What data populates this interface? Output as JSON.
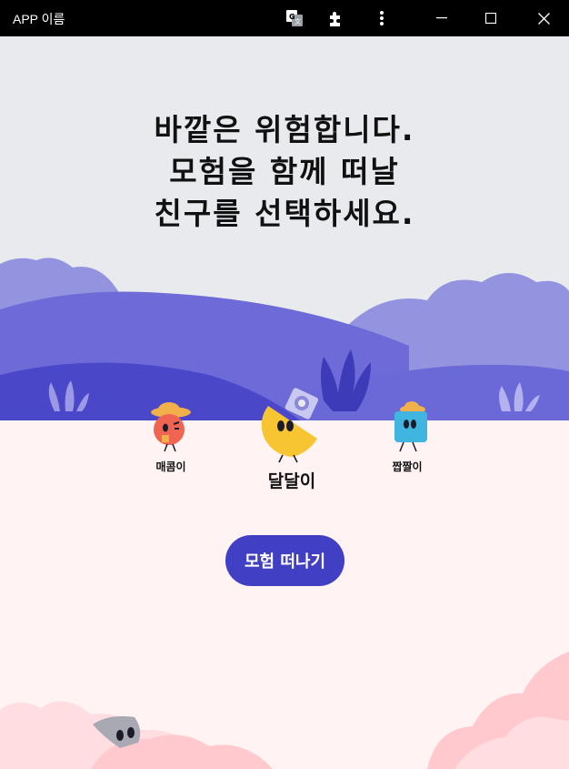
{
  "window": {
    "title": "APP 이름",
    "icons": [
      "translate-icon",
      "extension-icon",
      "more-vertical-icon",
      "minimize-icon",
      "maximize-icon",
      "close-icon"
    ]
  },
  "headline": {
    "line1": "바깥은 위험합니다.",
    "line2": "모험을 함께 떠날",
    "line3": "친구를 선택하세요."
  },
  "characters": [
    {
      "name": "매콤이",
      "selected": false
    },
    {
      "name": "달달이",
      "selected": true
    },
    {
      "name": "짭짤이",
      "selected": false
    }
  ],
  "start_button": {
    "label": "모험 떠나기"
  },
  "colors": {
    "titlebar": "#000000",
    "sky": "#e9eaee",
    "ground": "#fff3f4",
    "hill_light": "#9393e0",
    "hill_mid": "#6e6bd8",
    "hill_dark": "#4a47c9",
    "accent": "#4140c5",
    "cloud_pink": "#ffc9cd"
  }
}
